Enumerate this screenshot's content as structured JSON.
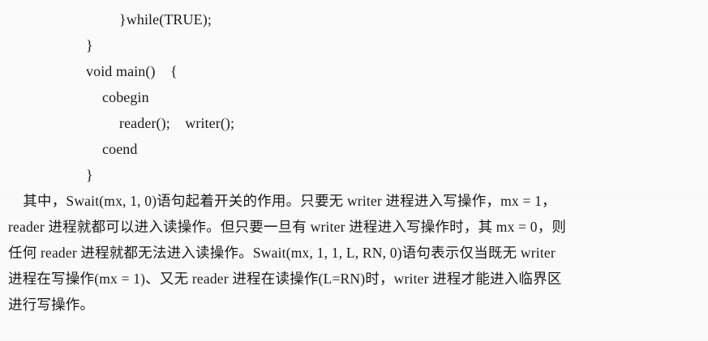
{
  "code": {
    "line1": "}while(TRUE);",
    "line2": "}",
    "line3": "void main()    {",
    "line4": "cobegin",
    "line5": "reader();    writer();",
    "line6": "coend",
    "line7": "}"
  },
  "paragraph": {
    "line1": "    其中，Swait(mx, 1, 0)语句起着开关的作用。只要无 writer 进程进入写操作，mx = 1，",
    "line2": "reader 进程就都可以进入读操作。但只要一旦有 writer 进程进入写操作时，其 mx = 0，则",
    "line3": "任何 reader 进程就都无法进入读操作。Swait(mx, 1, 1, L, RN, 0)语句表示仅当既无 writer",
    "line4": "进程在写操作(mx = 1)、又无 reader 进程在读操作(L=RN)时，writer 进程才能进入临界区",
    "line5": "进行写操作。"
  }
}
